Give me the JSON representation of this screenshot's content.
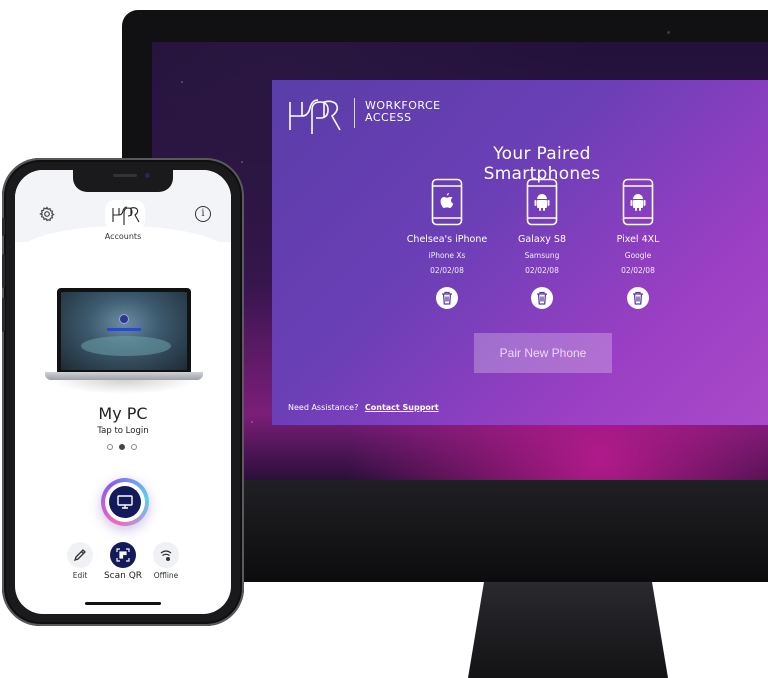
{
  "desktop": {
    "brand": {
      "line1": "WORKFORCE",
      "line2": "ACCESS"
    },
    "title": "Your Paired Smartphones",
    "phones": [
      {
        "name": "Chelsea's iPhone",
        "model": "iPhone Xs",
        "date": "02/02/08",
        "os_icon": "apple-icon"
      },
      {
        "name": "Galaxy S8",
        "model": "Samsung",
        "date": "02/02/08",
        "os_icon": "android-icon"
      },
      {
        "name": "Pixel 4XL",
        "model": "Google",
        "date": "02/02/08",
        "os_icon": "android-icon"
      }
    ],
    "pair_button": "Pair New Phone",
    "assist_text": "Need Assistance?",
    "assist_link": "Contact Support"
  },
  "mobile": {
    "tab": "Accounts",
    "device_name": "My PC",
    "device_action": "Tap to Login",
    "pager": {
      "count": 3,
      "active": 2
    },
    "actions": [
      {
        "label": "Edit",
        "icon": "pencil-icon"
      },
      {
        "label": "Scan QR",
        "icon": "qr-icon"
      },
      {
        "label": "Offline",
        "icon": "offline-icon"
      }
    ]
  },
  "colors": {
    "panel_start": "#5a3ea8",
    "panel_end": "#a94ac8",
    "app_dark": "#131a5a"
  }
}
